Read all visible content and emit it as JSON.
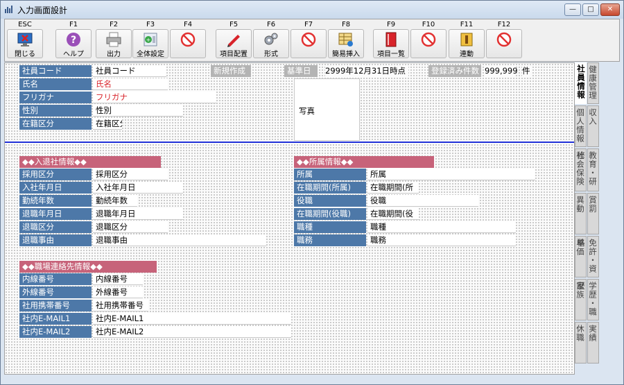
{
  "window": {
    "title": "入力画面設計",
    "minimize": "—",
    "maximize": "□",
    "close": "✕"
  },
  "toolbar": {
    "buttons": [
      {
        "key": "ESC",
        "label": "閉じる",
        "icon": "exit-monitor-icon"
      },
      {
        "key": "F1",
        "label": "ヘルプ",
        "icon": "help-icon"
      },
      {
        "key": "F2",
        "label": "出力",
        "icon": "printer-icon"
      },
      {
        "key": "F3",
        "label": "全体設定",
        "icon": "settings-icon"
      },
      {
        "key": "F4",
        "label": "",
        "icon": "disabled-icon"
      },
      {
        "key": "F5",
        "label": "項目配置",
        "icon": "pencil-icon"
      },
      {
        "key": "F6",
        "label": "形式",
        "icon": "gears-icon"
      },
      {
        "key": "F7",
        "label": "",
        "icon": "disabled-icon"
      },
      {
        "key": "F8",
        "label": "簡易挿入",
        "icon": "insert-table-icon"
      },
      {
        "key": "F9",
        "label": "項目一覧",
        "icon": "red-book-icon"
      },
      {
        "key": "F10",
        "label": "",
        "icon": "disabled-icon"
      },
      {
        "key": "F11",
        "label": "連動",
        "icon": "link-icon"
      },
      {
        "key": "F12",
        "label": "",
        "icon": "disabled-icon"
      }
    ]
  },
  "header": {
    "emp_code_label": "社員コード",
    "emp_code_value": "社員コード",
    "new_label": "新規作成",
    "base_date_label": "基準日",
    "base_date_value": "2999年12月31日時点",
    "registered_label": "登録済み件数",
    "registered_count": "999,999",
    "registered_unit": "件"
  },
  "basic": {
    "name_label": "氏名",
    "name_value": "氏名",
    "kana_label": "フリガナ",
    "kana_value": "フリガナ",
    "gender_label": "性別",
    "gender_value": "性別",
    "status_label": "在籍区分",
    "status_value": "在籍区分",
    "photo_label": "写真"
  },
  "join_section": {
    "title": "◆◆入退社情報◆◆",
    "rows": [
      {
        "label": "採用区分",
        "value": "採用区分"
      },
      {
        "label": "入社年月日",
        "value": "入社年月日"
      },
      {
        "label": "勤続年数",
        "value": "勤続年数"
      },
      {
        "label": "退職年月日",
        "value": "退職年月日"
      },
      {
        "label": "退職区分",
        "value": "退職区分"
      },
      {
        "label": "退職事由",
        "value": "退職事由"
      }
    ]
  },
  "affiliation_section": {
    "title": "◆◆所属情報◆◆",
    "rows": [
      {
        "label": "所属",
        "value": "所属"
      },
      {
        "label": "在職期間(所属)",
        "value": "在職期間(所"
      },
      {
        "label": "役職",
        "value": "役職"
      },
      {
        "label": "在職期間(役職)",
        "value": "在職期間(役"
      },
      {
        "label": "職種",
        "value": "職種"
      },
      {
        "label": "職務",
        "value": "職務"
      }
    ]
  },
  "contact_section": {
    "title": "◆◆職場連絡先情報◆◆",
    "rows": [
      {
        "label": "内線番号",
        "value": "内線番号"
      },
      {
        "label": "外線番号",
        "value": "外線番号"
      },
      {
        "label": "社用携帯番号",
        "value": "社用携帯番号"
      },
      {
        "label": "社内E-MAIL1",
        "value": "社内E-MAIL1"
      },
      {
        "label": "社内E-MAIL2",
        "value": "社内E-MAIL2"
      }
    ]
  },
  "side_tabs": [
    {
      "label": "社員情報",
      "active": true
    },
    {
      "label": "健康管理",
      "active": false
    },
    {
      "label": "個人情報",
      "active": false
    },
    {
      "label": "収入",
      "active": false
    },
    {
      "label": "社会保険",
      "active": false
    },
    {
      "label": "教育・研修",
      "active": false
    },
    {
      "label": "異動",
      "active": false
    },
    {
      "label": "賞罰",
      "active": false
    },
    {
      "label": "単価",
      "active": false
    },
    {
      "label": "免許・資格",
      "active": false
    },
    {
      "label": "家族",
      "active": false
    },
    {
      "label": "学歴・職歴",
      "active": false
    },
    {
      "label": "休職",
      "active": false
    },
    {
      "label": "実績",
      "active": false
    }
  ],
  "colors": {
    "label_bg": "#4d78a8",
    "section_bg": "#c7637a",
    "gray_label_bg": "#b4b4b4",
    "divider": "#2030d8",
    "red_text": "#d8232a"
  }
}
